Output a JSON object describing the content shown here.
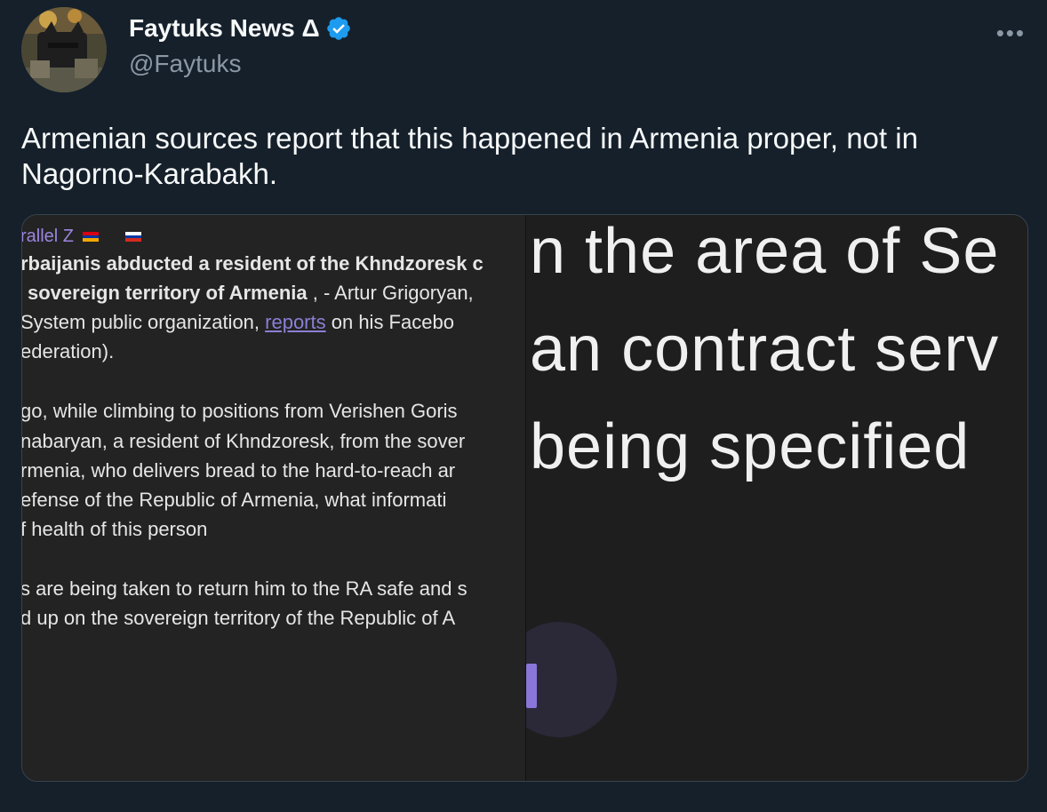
{
  "author": {
    "name": "Faytuks News Δ",
    "handle": "@Faytuks",
    "verified_icon": "verified-badge-icon",
    "avatar_icon": "avatar-image"
  },
  "menu": {
    "more_label": "•••"
  },
  "tweet": {
    "text": "Armenian sources report that this happened in Armenia proper, not in Nagorno-Karabakh."
  },
  "media": {
    "left": {
      "channel": "rallel Z",
      "lines": [
        "rbaijanis abducted a resident of the Khndzoresk c",
        "sovereign territory of Armenia",
        " , -   Artur Grigoryan,",
        "System public organization, ",
        "reports",
        " on his Facebo",
        "ederation).",
        "go, while climbing to positions from Verishen Goris",
        "nabaryan, a resident of Khndzoresk, from the sover",
        "rmenia, who delivers bread to the hard-to-reach ar",
        "efense of the Republic of Armenia, what informati",
        "f health of this person",
        "s are being taken to return him to the RA safe and s",
        "d up on the sovereign territory of the Republic of A"
      ]
    },
    "right": {
      "lines": [
        "n the area of Se",
        "an contract serv",
        "being specified"
      ]
    }
  },
  "colors": {
    "background": "#15202b",
    "verified": "#1d9bf0",
    "muted": "#8b98a5",
    "link": "#8b7fd6"
  }
}
